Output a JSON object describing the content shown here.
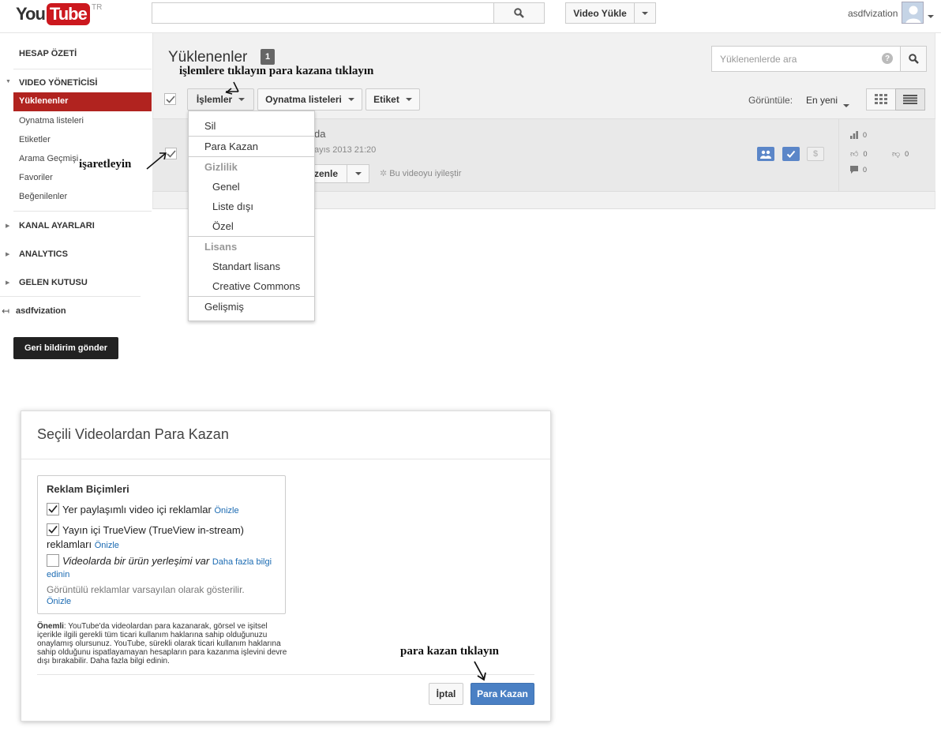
{
  "header": {
    "logo_you": "You",
    "logo_tube": "Tube",
    "logo_country": "TR",
    "upload_label": "Video Yükle",
    "username": "asdfvization"
  },
  "nav": {
    "account_overview": "HESAP ÖZETİ",
    "video_manager": "VIDEO YÖNETİCİSİ",
    "items": [
      "Yüklenenler",
      "Oynatma listeleri",
      "Etiketler",
      "Arama Geçmişi",
      "Favoriler",
      "Beğenilenler"
    ],
    "channel_settings": "KANAL AYARLARI",
    "analytics": "ANALYTICS",
    "inbox": "GELEN KUTUSU",
    "channel_link": "asdfvization",
    "feedback": "Geri bildirim gönder"
  },
  "main": {
    "title": "Yüklenenler",
    "count": "1",
    "search_placeholder": "Yüklenenlerde ara",
    "help": "?",
    "toolbar": {
      "actions": "İşlemler",
      "playlists": "Oynatma listeleri",
      "tags": "Etiket",
      "sort_label": "Görüntüle:",
      "sort_value": "En yeni"
    },
    "video": {
      "title": "da",
      "date": "ayıs 2013 21:20",
      "edit": "zenle",
      "improve": "Bu videoyu iyileştir",
      "money_icon": "$",
      "views": "0",
      "likes": "0",
      "dislikes": "0",
      "comments": "0"
    }
  },
  "dropdown": {
    "delete": "Sil",
    "monetize": "Para Kazan",
    "privacy_head": "Gizlilik",
    "public": "Genel",
    "unlisted": "Liste dışı",
    "private": "Özel",
    "license_head": "Lisans",
    "standard": "Standart lisans",
    "cc": "Creative Commons",
    "advanced": "Gelişmiş"
  },
  "annotations": {
    "top": "işlemlere tıklayın para kazana tıklayın",
    "check": "işaretleyin",
    "bottom": "para kazan tıklayın"
  },
  "dialog": {
    "title": "Seçili Videolardan Para Kazan",
    "ad_formats_title": "Reklam Biçimleri",
    "opt1": "Yer paylaşımlı video içi reklamlar",
    "opt2_line1": "Yayın içi TrueView (TrueView in-stream)",
    "opt2_line2": "reklamları",
    "opt3": "Videolarda bir ürün yerleşimi var",
    "preview": "Önizle",
    "learn_more_1": "Daha fazla bilgi",
    "learn_more_2": "edinin",
    "default_note": "Görüntülü reklamlar varsayılan olarak gösterilir.",
    "important_label": "Önemli",
    "important_text": ": YouTube'da videolardan para kazanarak, görsel ve işitsel içerikle ilgili gerekli tüm ticari kullanım haklarına sahip olduğunuzu onaylamış olursunuz. YouTube, sürekli olarak ticari kullanım haklarına sahip olduğunu ispatlayamayan hesapların para kazanma işlevini devre dışı bırakabilir. Daha fazla bilgi edinin.",
    "cancel": "İptal",
    "monetize": "Para Kazan"
  },
  "colors": {
    "nav_active": "#b1231f",
    "primary_button": "#4a80c4",
    "link": "#1a6ab2"
  }
}
